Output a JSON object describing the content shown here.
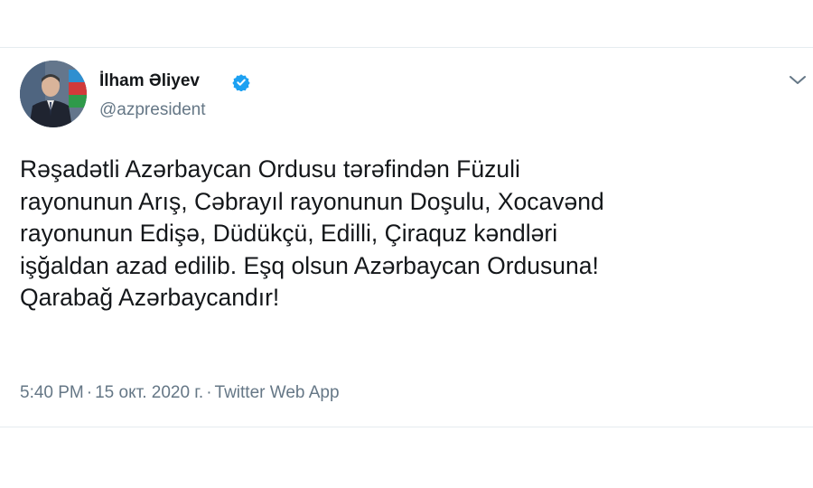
{
  "tweet": {
    "author": {
      "name": "İlham Əliyev",
      "handle": "@azpresident",
      "verified": true
    },
    "text_lines": [
      "Rəşadətli Azərbaycan Ordusu tərəfindən Füzuli",
      "rayonunun Arış, Cəbrayıl rayonunun Doşulu, Xocavənd",
      "rayonunun Edişə, Düdükçü, Edilli, Çiraquz kəndləri",
      "işğaldan azad edilib. Eşq olsun Azərbaycan Ordusuna!",
      "Qarabağ Azərbaycandır!"
    ],
    "time": "5:40 PM",
    "separator": "·",
    "date": "15 окт. 2020 г.",
    "source": "Twitter Web App"
  },
  "icons": {
    "verified": "verified-badge-icon",
    "menu": "chevron-down-icon"
  },
  "colors": {
    "verified_blue": "#1da1f2",
    "text": "#14171a",
    "secondary_text": "#657786",
    "divider": "#e6ecf0"
  }
}
